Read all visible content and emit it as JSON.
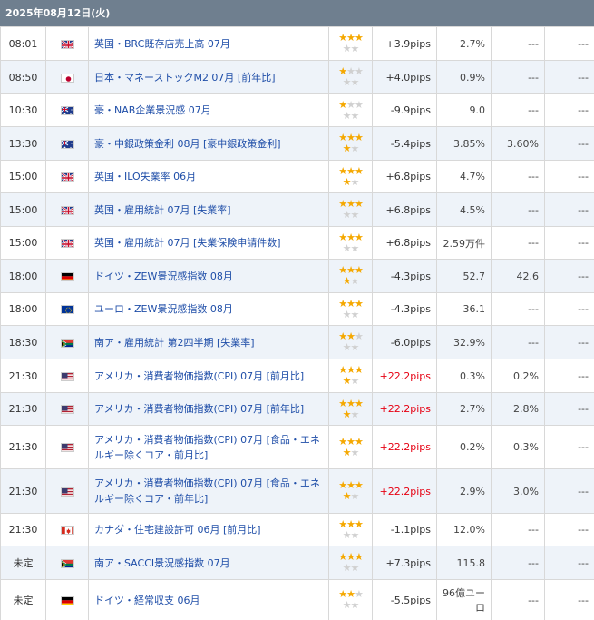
{
  "header": {
    "date": "2025年08月12日(火)"
  },
  "rows": [
    {
      "time": "08:01",
      "flag": "uk",
      "name": "英国・BRC既存店売上高 07月",
      "stars": 3,
      "pips": "+3.9pips",
      "red": false,
      "v1": "2.7%",
      "v2": "---",
      "v3": "---"
    },
    {
      "time": "08:50",
      "flag": "jp",
      "name": "日本・マネーストックM2 07月 [前年比]",
      "stars": 1,
      "pips": "+4.0pips",
      "red": false,
      "v1": "0.9%",
      "v2": "---",
      "v3": "---"
    },
    {
      "time": "10:30",
      "flag": "au",
      "name": "豪・NAB企業景況感 07月",
      "stars": 1,
      "pips": "-9.9pips",
      "red": false,
      "v1": "9.0",
      "v2": "---",
      "v3": "---"
    },
    {
      "time": "13:30",
      "flag": "au",
      "name": "豪・中銀政策金利 08月 [豪中銀政策金利]",
      "stars": 4,
      "pips": "-5.4pips",
      "red": false,
      "v1": "3.85%",
      "v2": "3.60%",
      "v3": "---"
    },
    {
      "time": "15:00",
      "flag": "uk",
      "name": "英国・ILO失業率 06月",
      "stars": 4,
      "pips": "+6.8pips",
      "red": false,
      "v1": "4.7%",
      "v2": "---",
      "v3": "---"
    },
    {
      "time": "15:00",
      "flag": "uk",
      "name": "英国・雇用統計 07月 [失業率]",
      "stars": 3,
      "pips": "+6.8pips",
      "red": false,
      "v1": "4.5%",
      "v2": "---",
      "v3": "---"
    },
    {
      "time": "15:00",
      "flag": "uk",
      "name": "英国・雇用統計 07月 [失業保険申請件数]",
      "stars": 3,
      "pips": "+6.8pips",
      "red": false,
      "v1": "2.59万件",
      "v2": "---",
      "v3": "---"
    },
    {
      "time": "18:00",
      "flag": "de",
      "name": "ドイツ・ZEW景況感指数 08月",
      "stars": 4,
      "pips": "-4.3pips",
      "red": false,
      "v1": "52.7",
      "v2": "42.6",
      "v3": "---"
    },
    {
      "time": "18:00",
      "flag": "eu",
      "name": "ユーロ・ZEW景況感指数 08月",
      "stars": 3,
      "pips": "-4.3pips",
      "red": false,
      "v1": "36.1",
      "v2": "---",
      "v3": "---"
    },
    {
      "time": "18:30",
      "flag": "za",
      "name": "南ア・雇用統計 第2四半期 [失業率]",
      "stars": 2,
      "pips": "-6.0pips",
      "red": false,
      "v1": "32.9%",
      "v2": "---",
      "v3": "---"
    },
    {
      "time": "21:30",
      "flag": "us",
      "name": "アメリカ・消費者物価指数(CPI) 07月 [前月比]",
      "stars": 4,
      "pips": "+22.2pips",
      "red": true,
      "v1": "0.3%",
      "v2": "0.2%",
      "v3": "---"
    },
    {
      "time": "21:30",
      "flag": "us",
      "name": "アメリカ・消費者物価指数(CPI) 07月 [前年比]",
      "stars": 4,
      "pips": "+22.2pips",
      "red": true,
      "v1": "2.7%",
      "v2": "2.8%",
      "v3": "---"
    },
    {
      "time": "21:30",
      "flag": "us",
      "name": "アメリカ・消費者物価指数(CPI) 07月 [食品・エネルギー除くコア・前月比]",
      "stars": 4,
      "pips": "+22.2pips",
      "red": true,
      "v1": "0.2%",
      "v2": "0.3%",
      "v3": "---"
    },
    {
      "time": "21:30",
      "flag": "us",
      "name": "アメリカ・消費者物価指数(CPI) 07月 [食品・エネルギー除くコア・前年比]",
      "stars": 4,
      "pips": "+22.2pips",
      "red": true,
      "v1": "2.9%",
      "v2": "3.0%",
      "v3": "---"
    },
    {
      "time": "21:30",
      "flag": "ca",
      "name": "カナダ・住宅建設許可 06月 [前月比]",
      "stars": 3,
      "pips": "-1.1pips",
      "red": false,
      "v1": "12.0%",
      "v2": "---",
      "v3": "---"
    },
    {
      "time": "未定",
      "flag": "za",
      "name": "南ア・SACCI景況感指数 07月",
      "stars": 3,
      "pips": "+7.3pips",
      "red": false,
      "v1": "115.8",
      "v2": "---",
      "v3": "---"
    },
    {
      "time": "未定",
      "flag": "de",
      "name": "ドイツ・経常収支 06月",
      "stars": 2,
      "pips": "-5.5pips",
      "red": false,
      "v1": "96億ユーロ",
      "v2": "---",
      "v3": "---"
    }
  ]
}
